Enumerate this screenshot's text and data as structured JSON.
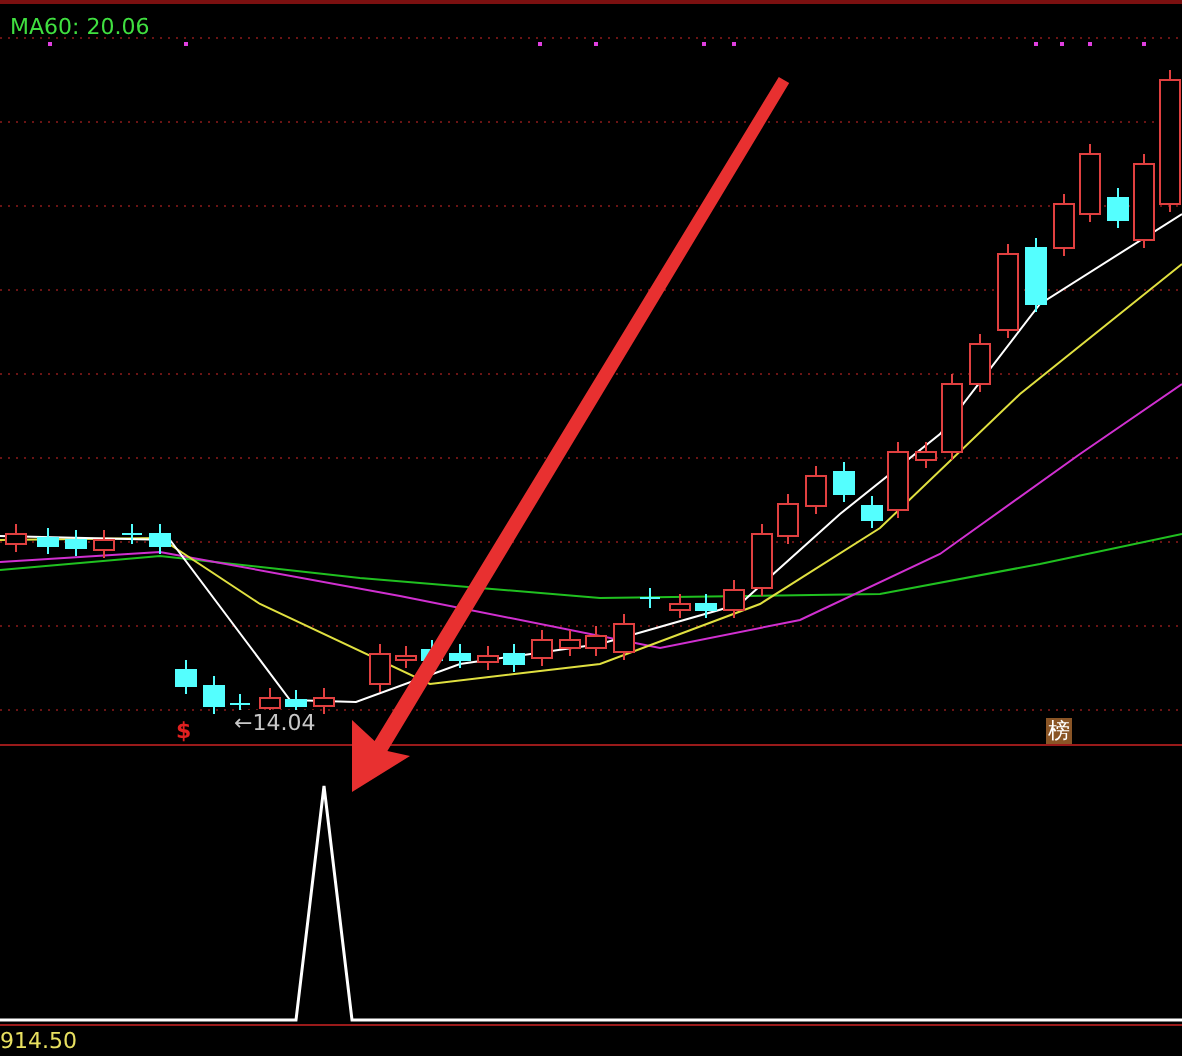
{
  "upper_panel": {
    "indicator_label": "MA60: 20.06",
    "price_marker": "←14.04",
    "signal_mark": "$",
    "badge": "榜"
  },
  "lower_panel": {
    "axis_value": "914.50"
  }
}
